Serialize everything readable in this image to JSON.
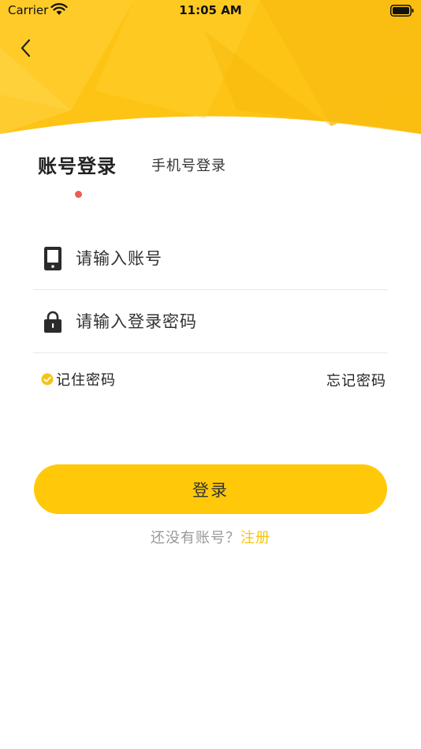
{
  "status_bar": {
    "carrier": "Carrier",
    "time": "11:05 AM"
  },
  "tabs": {
    "account_login": "账号登录",
    "phone_login": "手机号登录"
  },
  "form": {
    "account_placeholder": "请输入账号",
    "password_placeholder": "请输入登录密码",
    "remember_password": "记住密码",
    "forgot_password": "忘记密码",
    "remember_checked": true
  },
  "actions": {
    "login": "登录",
    "register_prompt": "还没有账号？",
    "register_link": "注册"
  },
  "colors": {
    "brand": "#ffc90a",
    "header_bg": "#fdc416",
    "active_tab_dot": "#ec5d57",
    "register_link": "#ffc300",
    "check": "#f5c418"
  },
  "icons": {
    "back": "chevron-left-icon",
    "account_field": "phone-icon",
    "password_field": "lock-icon",
    "remember": "check-circle-icon",
    "wifi": "wifi-icon",
    "battery": "battery-icon"
  }
}
